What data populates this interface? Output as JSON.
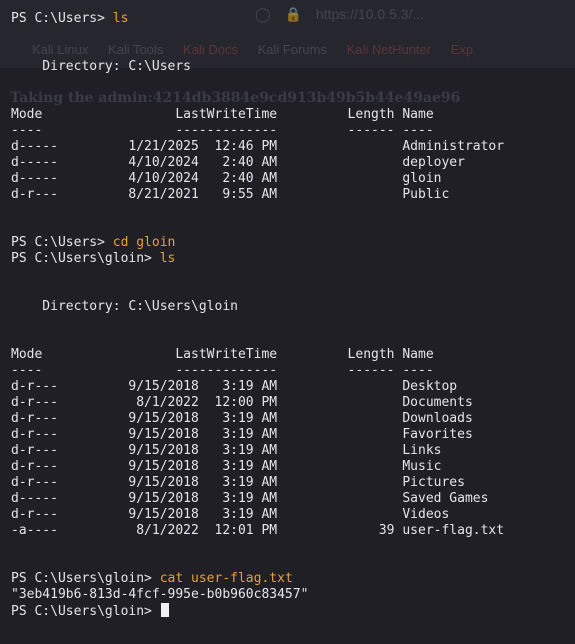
{
  "ghost_overlay": {
    "address_bar_text": "https://10.0.5.3/...",
    "bookmarks": [
      "Kali Linux",
      "Kali Tools",
      "Kali Docs",
      "Kali Forums",
      "Kali NetHunter",
      "Exp"
    ],
    "heading_text": "Taking the admin:4214db3884e9cd913b49b5b44e49ae96"
  },
  "terminal": {
    "lines": [
      {
        "prompt": "PS C:\\Users> ",
        "cmd": "ls"
      },
      {
        "text": ""
      },
      {
        "text": ""
      },
      {
        "text": "    Directory: C:\\Users"
      },
      {
        "text": ""
      },
      {
        "text": ""
      },
      {
        "text": "Mode                 LastWriteTime         Length Name"
      },
      {
        "text": "----                 -------------         ------ ----"
      },
      {
        "text": "d-----         1/21/2025  12:46 PM                Administrator"
      },
      {
        "text": "d-----         4/10/2024   2:40 AM                deployer"
      },
      {
        "text": "d-----         4/10/2024   2:40 AM                gloin"
      },
      {
        "text": "d-r---         8/21/2021   9:55 AM                Public"
      },
      {
        "text": ""
      },
      {
        "text": ""
      },
      {
        "prompt": "PS C:\\Users> ",
        "cmd": "cd gloin"
      },
      {
        "prompt": "PS C:\\Users\\gloin> ",
        "cmd": "ls"
      },
      {
        "text": ""
      },
      {
        "text": ""
      },
      {
        "text": "    Directory: C:\\Users\\gloin"
      },
      {
        "text": ""
      },
      {
        "text": ""
      },
      {
        "text": "Mode                 LastWriteTime         Length Name"
      },
      {
        "text": "----                 -------------         ------ ----"
      },
      {
        "text": "d-r---         9/15/2018   3:19 AM                Desktop"
      },
      {
        "text": "d-r---          8/1/2022  12:00 PM                Documents"
      },
      {
        "text": "d-r---         9/15/2018   3:19 AM                Downloads"
      },
      {
        "text": "d-r---         9/15/2018   3:19 AM                Favorites"
      },
      {
        "text": "d-r---         9/15/2018   3:19 AM                Links"
      },
      {
        "text": "d-r---         9/15/2018   3:19 AM                Music"
      },
      {
        "text": "d-r---         9/15/2018   3:19 AM                Pictures"
      },
      {
        "text": "d-----         9/15/2018   3:19 AM                Saved Games"
      },
      {
        "text": "d-r---         9/15/2018   3:19 AM                Videos"
      },
      {
        "text": "-a----          8/1/2022  12:01 PM             39 user-flag.txt"
      },
      {
        "text": ""
      },
      {
        "text": ""
      },
      {
        "prompt": "PS C:\\Users\\gloin> ",
        "cmd": "cat user-flag.txt"
      },
      {
        "text": "\"3eb419b6-813d-4fcf-995e-b0b960c83457\""
      },
      {
        "prompt": "PS C:\\Users\\gloin> ",
        "cmd": "",
        "cursor": true
      }
    ]
  },
  "colors": {
    "background": "#1f1f25",
    "text": "#e6e6e6",
    "command": "#e9a03b",
    "cursor": "#f0f0f0"
  }
}
